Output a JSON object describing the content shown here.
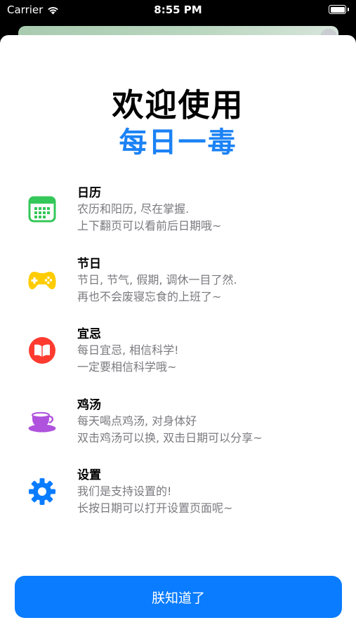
{
  "status_bar": {
    "carrier": "Carrier",
    "time": "8:55 PM"
  },
  "header": {
    "title": "欢迎使用",
    "app_name": "每日一毒"
  },
  "features": [
    {
      "icon": "calendar-icon",
      "color": "#34c759",
      "title": "日历",
      "line1": "农历和阳历, 尽在掌握.",
      "line2": "上下翻页可以看前后日期哦~"
    },
    {
      "icon": "gamecontroller-icon",
      "color": "#ffcc00",
      "title": "节日",
      "line1": "节日, 节气, 假期, 调休一目了然.",
      "line2": "再也不会废寝忘食的上班了~"
    },
    {
      "icon": "book-icon",
      "color": "#ff3b30",
      "title": "宜忌",
      "line1": "每日宜忌, 相信科学!",
      "line2": "一定要相信科学哦~"
    },
    {
      "icon": "cup-icon",
      "color": "#af52de",
      "title": "鸡汤",
      "line1": "每天喝点鸡汤, 对身体好",
      "line2": "双击鸡汤可以换, 双击日期可以分享~"
    },
    {
      "icon": "gear-icon",
      "color": "#0a7cff",
      "title": "设置",
      "line1": "我们是支持设置的!",
      "line2": "长按日期可以打开设置页面呢~"
    }
  ],
  "footer": {
    "button_label": "朕知道了"
  },
  "colors": {
    "accent": "#0a7cff",
    "title_blue": "#1a82f5"
  }
}
